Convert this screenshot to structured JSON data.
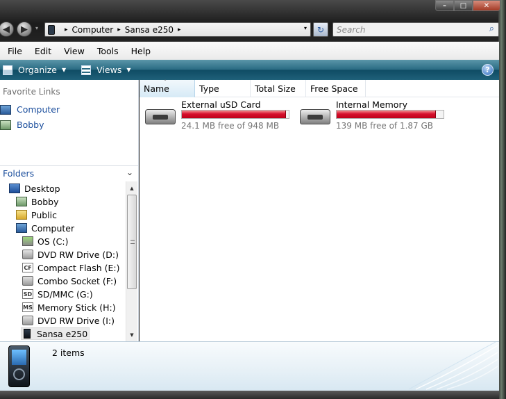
{
  "window": {
    "minimize_label": "–",
    "maximize_label": "□",
    "close_label": "✕"
  },
  "nav": {
    "back_icon": "◀",
    "forward_icon": "▶",
    "recent_icon": "▾"
  },
  "address": {
    "crumbs": [
      "Computer",
      "Sansa e250"
    ],
    "separator": "▸",
    "refresh_icon": "↻"
  },
  "search": {
    "placeholder": "Search",
    "icon": "⌕"
  },
  "menubar": {
    "items": [
      "File",
      "Edit",
      "View",
      "Tools",
      "Help"
    ]
  },
  "toolbar": {
    "organize_label": "Organize",
    "views_label": "Views",
    "caret": "▼",
    "help_label": "?",
    "colors": {
      "bar_top": "#5b96a9",
      "bar_bottom": "#0f4c64"
    }
  },
  "navpane": {
    "favorites_title": "Favorite Links",
    "favorites": [
      {
        "label": "Computer",
        "icon": "computer-icon"
      },
      {
        "label": "Bobby",
        "icon": "user-folder-icon"
      }
    ],
    "folders_title": "Folders",
    "folders_chevron": "⌄",
    "tree": [
      {
        "label": "Desktop",
        "icon": "desktop-icon"
      },
      {
        "label": "Bobby",
        "icon": "user-folder-icon"
      },
      {
        "label": "Public",
        "icon": "folder-icon"
      },
      {
        "label": "Computer",
        "icon": "computer-icon"
      },
      {
        "label": "OS (C:)",
        "icon": "os-drive-icon"
      },
      {
        "label": "DVD RW Drive (D:)",
        "icon": "dvd-drive-icon"
      },
      {
        "label": "Compact Flash (E:)",
        "icon": "compact-flash-icon",
        "badge": "CF"
      },
      {
        "label": "Combo Socket (F:)",
        "icon": "removable-drive-icon"
      },
      {
        "label": "SD/MMC (G:)",
        "icon": "sd-card-icon",
        "badge": "SD"
      },
      {
        "label": "Memory Stick (H:)",
        "icon": "memory-stick-icon",
        "badge": "MS"
      },
      {
        "label": "DVD RW Drive (I:)",
        "icon": "dvd-drive-icon"
      },
      {
        "label": "Sansa e250",
        "icon": "media-player-icon",
        "selected": true
      }
    ],
    "scroll_up": "▲",
    "scroll_down": "▼"
  },
  "content": {
    "columns": [
      "Name",
      "Type",
      "Total Size",
      "Free Space"
    ],
    "sort_indicator": "ˆ",
    "drives": [
      {
        "name": "External uSD Card",
        "free_text": "24.1 MB free of 948 MB",
        "used_fraction": 0.975,
        "icon": "hard-drive-icon"
      },
      {
        "name": "Internal Memory",
        "free_text": "139 MB free of 1.87 GB",
        "used_fraction": 0.927,
        "icon": "hard-drive-icon"
      }
    ],
    "bar_color": "#d6102d"
  },
  "details": {
    "item_count": "2 items",
    "icon": "media-player-icon"
  }
}
